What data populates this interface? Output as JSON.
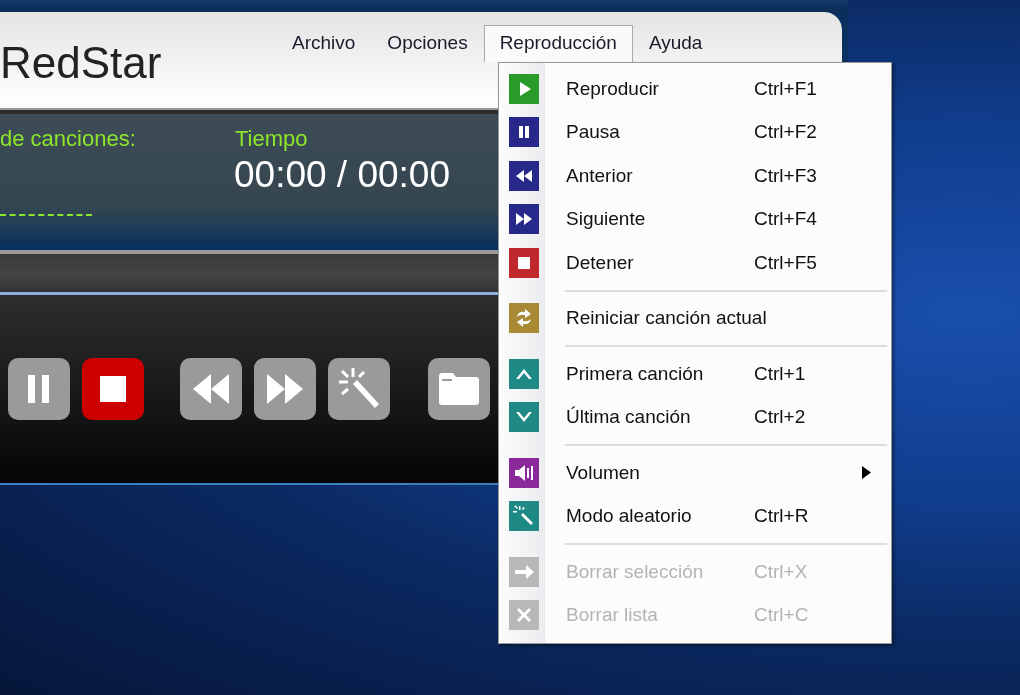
{
  "window": {
    "logo": "RedStar"
  },
  "menu_bar": [
    {
      "label": "Archivo",
      "selected": false
    },
    {
      "label": "Opciones",
      "selected": false
    },
    {
      "label": "Reproducción",
      "selected": true
    },
    {
      "label": "Ayuda",
      "selected": false
    }
  ],
  "display": {
    "songs_label": "de canciones:",
    "time_label": "Tiempo",
    "time": "00:00 / 00:00"
  },
  "dropdown": [
    {
      "kind": "item",
      "label": "Reproducir",
      "shortcut": "Ctrl+F1",
      "disabled": false,
      "submenu": false
    },
    {
      "kind": "item",
      "label": "Pausa",
      "shortcut": "Ctrl+F2",
      "disabled": false,
      "submenu": false
    },
    {
      "kind": "item",
      "label": "Anterior",
      "shortcut": "Ctrl+F3",
      "disabled": false,
      "submenu": false
    },
    {
      "kind": "item",
      "label": "Siguiente",
      "shortcut": "Ctrl+F4",
      "disabled": false,
      "submenu": false
    },
    {
      "kind": "item",
      "label": "Detener",
      "shortcut": "Ctrl+F5",
      "disabled": false,
      "submenu": false
    },
    {
      "kind": "separator"
    },
    {
      "kind": "item",
      "label": "Reiniciar canción actual",
      "disabled": false,
      "submenu": false
    },
    {
      "kind": "separator"
    },
    {
      "kind": "item",
      "label": "Primera canción",
      "shortcut": "Ctrl+1",
      "disabled": false,
      "submenu": false
    },
    {
      "kind": "item",
      "label": "Última canción",
      "shortcut": "Ctrl+2",
      "disabled": false,
      "submenu": false
    },
    {
      "kind": "separator"
    },
    {
      "kind": "item",
      "label": "Volumen",
      "disabled": false,
      "submenu": true
    },
    {
      "kind": "item",
      "label": "Modo aleatorio",
      "shortcut": "Ctrl+R",
      "disabled": false,
      "submenu": false
    },
    {
      "kind": "separator"
    },
    {
      "kind": "item",
      "label": "Borrar selección",
      "shortcut": "Ctrl+X",
      "disabled": true,
      "submenu": false
    },
    {
      "kind": "item",
      "label": "Borrar lista",
      "shortcut": "Ctrl+C",
      "disabled": true,
      "submenu": false
    }
  ]
}
